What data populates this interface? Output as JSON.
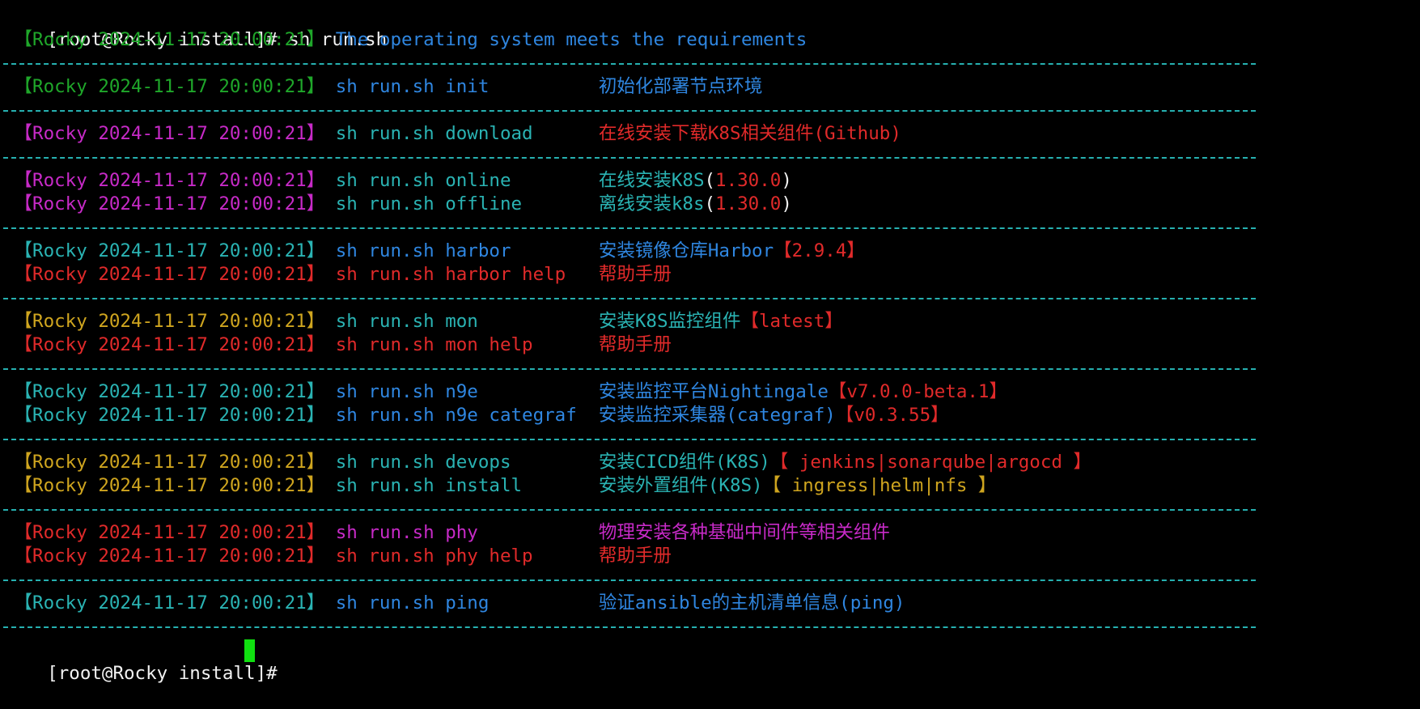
{
  "colors": {
    "background": "#000000",
    "white": "#f2f2f2",
    "cyan": "#2ab3b3",
    "blue": "#2f86e0",
    "green": "#1fa72a",
    "magenta": "#c72ac7",
    "red": "#e02a2a",
    "yellow": "#cfa51f",
    "separator": "#26b0b0",
    "cursor": "#10e010"
  },
  "prompt": {
    "text": "[root@Rocky install]# ",
    "command": "sh run.sh"
  },
  "lines": [
    {
      "row": 1,
      "segs": [
        {
          "t": " 【Rocky 2024-11-17 20:00:21】 ",
          "c": "green"
        },
        {
          "t": "The operating system meets the requirements",
          "c": "blue"
        }
      ]
    },
    {
      "sep": true
    },
    {
      "row": 3,
      "segs": [
        {
          "t": " 【Rocky 2024-11-17 20:00:21】 ",
          "c": "green"
        },
        {
          "t": "sh run.sh init          ",
          "c": "blue"
        },
        {
          "t": "初始化部署节点环境",
          "c": "blue"
        }
      ]
    },
    {
      "sep": true
    },
    {
      "row": 5,
      "segs": [
        {
          "t": " 【Rocky 2024-11-17 20:00:21】 ",
          "c": "magenta"
        },
        {
          "t": "sh run.sh download      ",
          "c": "cyan"
        },
        {
          "t": "在线安装下载K8S相关组件(Github)",
          "c": "red"
        }
      ]
    },
    {
      "sep": true
    },
    {
      "row": 7,
      "segs": [
        {
          "t": " 【Rocky 2024-11-17 20:00:21】 ",
          "c": "magenta"
        },
        {
          "t": "sh run.sh online        ",
          "c": "cyan"
        },
        {
          "t": "在线安装K8S",
          "c": "cyan"
        },
        {
          "t": "(",
          "c": "white"
        },
        {
          "t": "1.30.0",
          "c": "red"
        },
        {
          "t": ")",
          "c": "white"
        }
      ]
    },
    {
      "row": 8,
      "segs": [
        {
          "t": " 【Rocky 2024-11-17 20:00:21】 ",
          "c": "magenta"
        },
        {
          "t": "sh run.sh offline       ",
          "c": "cyan"
        },
        {
          "t": "离线安装k8s",
          "c": "cyan"
        },
        {
          "t": "(",
          "c": "white"
        },
        {
          "t": "1.30.0",
          "c": "red"
        },
        {
          "t": ")",
          "c": "white"
        }
      ]
    },
    {
      "sep": true
    },
    {
      "row": 10,
      "segs": [
        {
          "t": " 【Rocky 2024-11-17 20:00:21】 ",
          "c": "cyan"
        },
        {
          "t": "sh run.sh harbor        ",
          "c": "blue"
        },
        {
          "t": "安装镜像仓库Harbor",
          "c": "blue"
        },
        {
          "t": "【2.9.4】",
          "c": "red"
        }
      ]
    },
    {
      "row": 11,
      "segs": [
        {
          "t": " 【Rocky 2024-11-17 20:00:21】 ",
          "c": "red"
        },
        {
          "t": "sh run.sh harbor help   ",
          "c": "red"
        },
        {
          "t": "帮助手册",
          "c": "red"
        }
      ]
    },
    {
      "sep": true
    },
    {
      "row": 13,
      "segs": [
        {
          "t": " 【Rocky 2024-11-17 20:00:21】 ",
          "c": "yellow"
        },
        {
          "t": "sh run.sh mon           ",
          "c": "cyan"
        },
        {
          "t": "安装K8S监控组件",
          "c": "cyan"
        },
        {
          "t": "【latest】",
          "c": "red"
        }
      ]
    },
    {
      "row": 14,
      "segs": [
        {
          "t": " 【Rocky 2024-11-17 20:00:21】 ",
          "c": "red"
        },
        {
          "t": "sh run.sh mon help      ",
          "c": "red"
        },
        {
          "t": "帮助手册",
          "c": "red"
        }
      ]
    },
    {
      "sep": true
    },
    {
      "row": 16,
      "segs": [
        {
          "t": " 【Rocky 2024-11-17 20:00:21】 ",
          "c": "cyan"
        },
        {
          "t": "sh run.sh n9e           ",
          "c": "blue"
        },
        {
          "t": "安装监控平台Nightingale",
          "c": "blue"
        },
        {
          "t": "【v7.0.0-beta.1】",
          "c": "red"
        }
      ]
    },
    {
      "row": 17,
      "segs": [
        {
          "t": " 【Rocky 2024-11-17 20:00:21】 ",
          "c": "cyan"
        },
        {
          "t": "sh run.sh n9e categraf  ",
          "c": "blue"
        },
        {
          "t": "安装监控采集器(categraf)",
          "c": "blue"
        },
        {
          "t": "【v0.3.55】",
          "c": "red"
        }
      ]
    },
    {
      "sep": true
    },
    {
      "row": 19,
      "segs": [
        {
          "t": " 【Rocky 2024-11-17 20:00:21】 ",
          "c": "yellow"
        },
        {
          "t": "sh run.sh devops        ",
          "c": "cyan"
        },
        {
          "t": "安装CICD组件(K8S)",
          "c": "cyan"
        },
        {
          "t": "【 jenkins|sonarqube|argocd 】",
          "c": "red"
        }
      ]
    },
    {
      "row": 20,
      "segs": [
        {
          "t": " 【Rocky 2024-11-17 20:00:21】 ",
          "c": "yellow"
        },
        {
          "t": "sh run.sh install       ",
          "c": "cyan"
        },
        {
          "t": "安装外置组件(K8S)",
          "c": "cyan"
        },
        {
          "t": "【 ingress|helm|nfs 】",
          "c": "yellow"
        }
      ]
    },
    {
      "sep": true
    },
    {
      "row": 22,
      "segs": [
        {
          "t": " 【Rocky 2024-11-17 20:00:21】 ",
          "c": "red"
        },
        {
          "t": "sh run.sh phy           ",
          "c": "magenta"
        },
        {
          "t": "物理安装各种基础中间件等相关组件",
          "c": "magenta"
        }
      ]
    },
    {
      "row": 23,
      "segs": [
        {
          "t": " 【Rocky 2024-11-17 20:00:21】 ",
          "c": "red"
        },
        {
          "t": "sh run.sh phy help      ",
          "c": "red"
        },
        {
          "t": "帮助手册",
          "c": "red"
        }
      ]
    },
    {
      "sep": true
    },
    {
      "row": 25,
      "segs": [
        {
          "t": " 【Rocky 2024-11-17 20:00:21】 ",
          "c": "cyan"
        },
        {
          "t": "sh run.sh ping          ",
          "c": "blue"
        },
        {
          "t": "验证ansible的主机清单信息(ping)",
          "c": "blue"
        }
      ]
    },
    {
      "sep": true
    }
  ],
  "final_prompt": "[root@Rocky install]# "
}
